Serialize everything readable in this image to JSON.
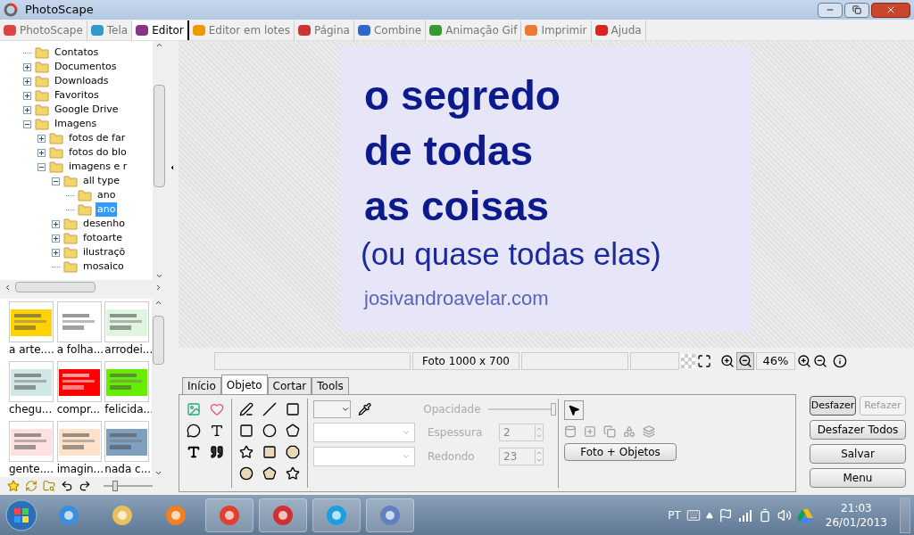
{
  "window": {
    "title": "PhotoScape"
  },
  "tabs": [
    {
      "label": "PhotoScape",
      "selected": false
    },
    {
      "label": "Tela",
      "selected": false
    },
    {
      "label": "Editor",
      "selected": true
    },
    {
      "label": "Editor em lotes",
      "selected": false
    },
    {
      "label": "Página",
      "selected": false
    },
    {
      "label": "Combine",
      "selected": false
    },
    {
      "label": "Animação Gif",
      "selected": false
    },
    {
      "label": "Imprimir",
      "selected": false
    },
    {
      "label": "Ajuda",
      "selected": false
    }
  ],
  "folder_tree": [
    {
      "label": "Contatos",
      "kind": "leaf",
      "selected": false
    },
    {
      "label": "Documentos",
      "kind": "folder",
      "expanded": false,
      "selected": false
    },
    {
      "label": "Downloads",
      "kind": "folder",
      "expanded": false,
      "selected": false
    },
    {
      "label": "Favoritos",
      "kind": "folder",
      "expanded": false,
      "selected": false
    },
    {
      "label": "Google Drive",
      "kind": "folder",
      "expanded": false,
      "selected": false
    },
    {
      "label": "Imagens",
      "kind": "folder",
      "expanded": true,
      "selected": false,
      "children": [
        {
          "label": "fotos de far",
          "kind": "folder",
          "expanded": false,
          "selected": false
        },
        {
          "label": "fotos do blo",
          "kind": "folder",
          "expanded": false,
          "selected": false
        },
        {
          "label": "imagens e r",
          "kind": "folder",
          "expanded": true,
          "selected": false,
          "children": [
            {
              "label": "all type",
              "kind": "folder",
              "expanded": true,
              "selected": false,
              "children": [
                {
                  "label": "ano",
                  "kind": "leaf",
                  "selected": false
                },
                {
                  "label": "ano",
                  "kind": "leaf",
                  "selected": true
                }
              ]
            },
            {
              "label": "desenho",
              "kind": "folder",
              "expanded": false,
              "selected": false
            },
            {
              "label": "fotoarte",
              "kind": "folder",
              "expanded": false,
              "selected": false
            },
            {
              "label": "ilustraçõ",
              "kind": "folder",
              "expanded": false,
              "selected": false
            },
            {
              "label": "mosaico",
              "kind": "leaf",
              "selected": false
            }
          ]
        }
      ]
    }
  ],
  "thumbnails": [
    {
      "caption": "a arte...."
    },
    {
      "caption": "a folha..."
    },
    {
      "caption": "arrodei..."
    },
    {
      "caption": "chegu..."
    },
    {
      "caption": "compr..."
    },
    {
      "caption": "felicida..."
    },
    {
      "caption": "gente...."
    },
    {
      "caption": "imagin..."
    },
    {
      "caption": "nada c..."
    }
  ],
  "thumb_size": {
    "level": 0.2
  },
  "canvas": {
    "headline": [
      "o segredo",
      "de todas",
      "as coisas"
    ],
    "subtitle": "(ou quase todas elas)",
    "url": "josivandroavelar.com"
  },
  "status_bar": {
    "photo_size": "Foto 1000 x 700",
    "zoom": "46%"
  },
  "editor_tabs": [
    {
      "label": "Início",
      "selected": false
    },
    {
      "label": "Objeto",
      "selected": true
    },
    {
      "label": "Cortar",
      "selected": false
    },
    {
      "label": "Tools",
      "selected": false
    }
  ],
  "object_panel": {
    "opacity_label": "Opacidade",
    "opacity": {
      "level": 1,
      "disabled": true
    },
    "fields": [
      {
        "label": "Espessura",
        "value": "2",
        "disabled": true
      },
      {
        "label": "Redondo",
        "value": "23",
        "disabled": true
      }
    ],
    "photo_objects_button": "Foto + Objetos"
  },
  "actions": [
    {
      "label": "Desfazer",
      "disabled": false
    },
    {
      "label": "Refazer",
      "disabled": true
    },
    {
      "label": "Desfazer Todos",
      "disabled": false
    },
    {
      "label": "Salvar",
      "disabled": false
    },
    {
      "label": "Menu",
      "disabled": false
    }
  ],
  "tray": {
    "language": "PT",
    "time": "21:03",
    "date": "26/01/2013"
  }
}
